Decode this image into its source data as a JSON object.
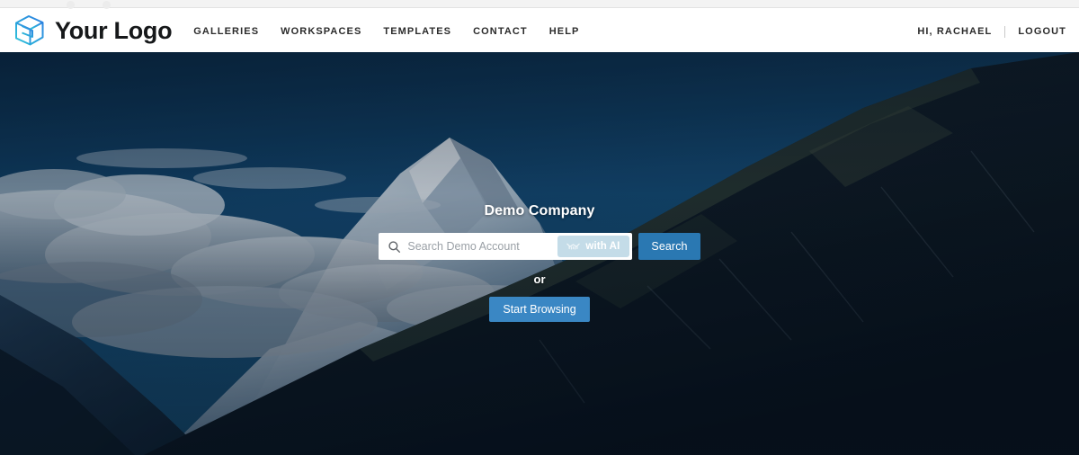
{
  "browser_chrome": {
    "visible": true
  },
  "header": {
    "logo": {
      "icon": "cube-logo-icon",
      "brand_name": "Your Logo"
    },
    "nav_items": [
      {
        "label": "GALLERIES",
        "name": "nav-galleries"
      },
      {
        "label": "WORKSPACES",
        "name": "nav-workspaces"
      },
      {
        "label": "TEMPLATES",
        "name": "nav-templates"
      },
      {
        "label": "CONTACT",
        "name": "nav-contact"
      },
      {
        "label": "HELP",
        "name": "nav-help"
      }
    ],
    "user_greeting": "HI, RACHAEL",
    "logout_label": "LOGOUT"
  },
  "hero": {
    "title": "Demo Company",
    "search": {
      "placeholder": "Search Demo Account",
      "value": "",
      "icon": "search-icon",
      "ai_button_label": "with AI",
      "ai_button_icon": "ai-sparkle-icon",
      "submit_label": "Search"
    },
    "or_label": "or",
    "browse_label": "Start Browsing",
    "background": {
      "subject": "snow-capped mountain landscape with clouds",
      "sky_color": "#0d3a5c",
      "ridge_color": "#0b1a26",
      "snow_color": "#cfdce8"
    }
  },
  "colors": {
    "accent_blue": "#2a78b2",
    "browse_blue": "#3a87c4",
    "ai_pill": "#c4dce8",
    "logo_cyan": "#2fc4d9",
    "logo_blue": "#2a7de1",
    "nav_text": "#2b2b2b"
  }
}
